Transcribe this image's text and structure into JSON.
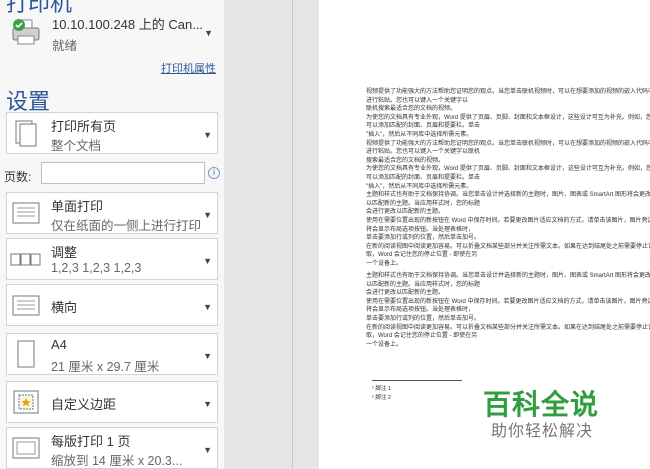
{
  "printer": {
    "section_title": "打印机",
    "name": "10.10.100.248 上的 Can...",
    "status": "就绪",
    "properties_link": "打印机属性"
  },
  "settings": {
    "title": "设置",
    "pages_label": "页数:",
    "pages_value": "",
    "items": [
      {
        "title": "打印所有页",
        "subtitle": "整个文档"
      },
      {
        "title": "单面打印",
        "subtitle": "仅在纸面的一侧上进行打印"
      },
      {
        "title": "调整",
        "subtitle": "1,2,3    1,2,3    1,2,3"
      },
      {
        "title": "横向",
        "subtitle": ""
      },
      {
        "title": "A4",
        "subtitle": "21 厘米 x 29.7 厘米"
      },
      {
        "title": "自定义边距",
        "subtitle": ""
      },
      {
        "title": "每版打印 1 页",
        "subtitle": "缩放到 14 厘米 x 20.3..."
      }
    ]
  },
  "preview": {
    "lines_a": [
      "视频提供了功能强大的方法帮助您证明您的观点。当您单击联机视频时，可以在想要添加的视频的嵌入代码中进行粘贴。您也可以键入一个关键字以",
      "联机搜索最适合您的文档的视频。",
      "为使您的文档具有专业外观，Word 提供了页眉、页脚、封面和文本框设计，这些设计可互为补充。例如，您可以添加匹配的封面、页眉和提要栏。单击",
      "\"插入\"，然后从不同库中选择所需元素。",
      "视频提供了功能强大的方法帮助您证明您的观点。当您单击联机视频时，可以在想要添加的视频的嵌入代码中进行粘贴。您也可以键入一个关键字以联机",
      "搜索最适合您的文档的视频。",
      "为使您的文档具有专业外观，Word 提供了页眉、页脚、封面和文本框设计，这些设计可互为补充。例如，您可以添加匹配的封面、页眉和提要栏。单击",
      "\"插入\"，然后从不同库中选择所需元素。",
      "主题和样式也有助于文档保持协调。当您单击设计并选择新的主题时，图片、图表或 SmartArt 图形将会更改以匹配新的主题。当应用样式时，您的标题",
      "会进行更改以匹配新的主题。",
      "使用在需要位置出现的新按钮在 Word 中保存时间。若要更改图片适应文档的方式，请单击该图片，图片旁边将会显示布局选项按钮。当处理表格时，",
      "单击要添加行或列的位置，然后单击加号。",
      "在新的阅读视图中阅读更加容易。可以折叠文档某些部分并关注所需文本。如果在达到结尾处之前需要停止读取，Word 会记住您的停止位置 - 即使在另",
      "一个设备上。"
    ],
    "lines_b": [
      "主题和样式也有助于文档保持协调。当您单击设计并选择新的主题时，图片、图表或 SmartArt 图形将会更改以匹配新的主题。当应用样式时，您的标题",
      "会进行更改以匹配新的主题。",
      "使用在需要位置出现的新按钮在 Word 中保存时间。若要更改图片适应文档的方式，请单击该图片，图片旁边将会显示布局选项按钮。当处理表格时，",
      "单击要添加行或列的位置，然后单击加号。",
      "在新的阅读视图中阅读更加容易。可以折叠文档某些部分并关注所需文本。如果在达到结尾处之前需要停止读取，Word 会记住您的停止位置 - 即使在另",
      "一个设备上。"
    ],
    "footnotes": [
      "¹ 脚注 1",
      "² 脚注 2"
    ]
  },
  "watermark": {
    "title": "百科全说",
    "subtitle": "助你轻松解决"
  }
}
